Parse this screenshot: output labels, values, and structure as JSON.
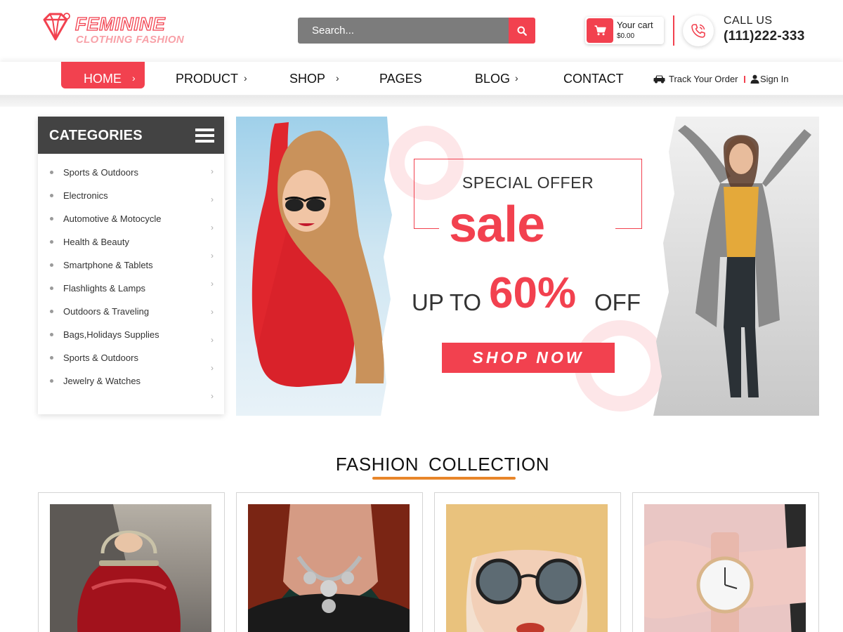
{
  "brand": {
    "name": "FEMININE",
    "tagline": "CLOTHING FASHION"
  },
  "search": {
    "placeholder": "Search..."
  },
  "cart": {
    "label": "Your cart",
    "total": "$0.00"
  },
  "contact": {
    "label": "CALL US",
    "phone": "(111)222-333"
  },
  "nav": {
    "items": [
      {
        "label": "HOME",
        "chevron": "›"
      },
      {
        "label": "PRODUCT",
        "chevron": "›"
      },
      {
        "label": "SHOP",
        "chevron": "›"
      },
      {
        "label": "PAGES"
      },
      {
        "label": "BLOG",
        "chevron": "›"
      },
      {
        "label": "CONTACT"
      }
    ],
    "track_order": "Track Your Order",
    "sign_in": "Sign In"
  },
  "categories": {
    "title": "CATEGORIES",
    "items": [
      {
        "label": "Sports & Outdoors"
      },
      {
        "label": "Electronics"
      },
      {
        "label": "Automotive & Motocycle"
      },
      {
        "label": "Health & Beauty"
      },
      {
        "label": "Smartphone & Tablets"
      },
      {
        "label": "Flashlights & Lamps"
      },
      {
        "label": "Outdoors & Traveling"
      },
      {
        "label": "Bags,Holidays Supplies"
      },
      {
        "label": "Sports & Outdoors"
      },
      {
        "label": "Jewelry & Watches"
      }
    ]
  },
  "hero": {
    "special_offer": "SPECIAL OFFER",
    "sale": "sale",
    "up_to": "UP TO",
    "percent": "60%",
    "off": "OFF",
    "cta": "SHOP NOW"
  },
  "collection": {
    "title": "FASHION  COLLECTION",
    "cards": [
      {
        "subject": "red-handbag"
      },
      {
        "subject": "statement-necklace"
      },
      {
        "subject": "sunglasses"
      },
      {
        "subject": "wrist-watch"
      }
    ]
  },
  "colors": {
    "accent": "#f2414f",
    "dark": "#434343",
    "underline": "#e8862a",
    "ring": "#fde6e8"
  }
}
